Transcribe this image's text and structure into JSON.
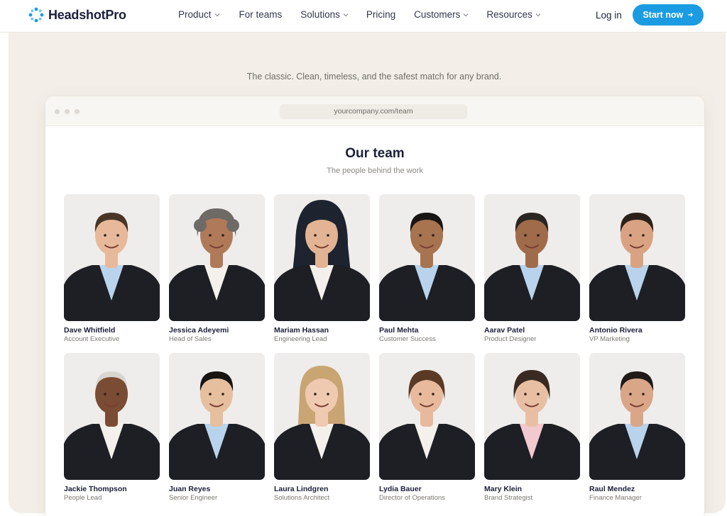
{
  "brand": {
    "name": "HeadshotPro",
    "color": "#1b9ce2"
  },
  "nav": {
    "items": [
      {
        "label": "Product",
        "has_dropdown": true
      },
      {
        "label": "For teams",
        "has_dropdown": false
      },
      {
        "label": "Solutions",
        "has_dropdown": true
      },
      {
        "label": "Pricing",
        "has_dropdown": false
      },
      {
        "label": "Customers",
        "has_dropdown": true
      },
      {
        "label": "Resources",
        "has_dropdown": true
      }
    ],
    "login_label": "Log in",
    "cta_label": "Start now",
    "cta_icon": "arrow-right-icon"
  },
  "section": {
    "tagline": "The classic. Clean, timeless, and the safest match for any brand."
  },
  "browser": {
    "url": "yourcompany.com/team",
    "title": "Our team",
    "subtitle": "The people behind the work"
  },
  "people": [
    {
      "name": "Dave Whitfield",
      "role": "Account Executive"
    },
    {
      "name": "Jessica Adeyemi",
      "role": "Head of Sales"
    },
    {
      "name": "Mariam Hassan",
      "role": "Engineering Lead"
    },
    {
      "name": "Paul Mehta",
      "role": "Customer Success"
    },
    {
      "name": "Aarav Patel",
      "role": "Product Designer"
    },
    {
      "name": "Antonio Rivera",
      "role": "VP Marketing"
    },
    {
      "name": "Jackie Thompson",
      "role": "People Lead"
    },
    {
      "name": "Juan Reyes",
      "role": "Senior Engineer"
    },
    {
      "name": "Laura Lindgren",
      "role": "Solutions Architect"
    },
    {
      "name": "Lydia Bauer",
      "role": "Director of Operations"
    },
    {
      "name": "Mary Klein",
      "role": "Brand Strategist"
    },
    {
      "name": "Raul Mendez",
      "role": "Finance Manager"
    }
  ]
}
